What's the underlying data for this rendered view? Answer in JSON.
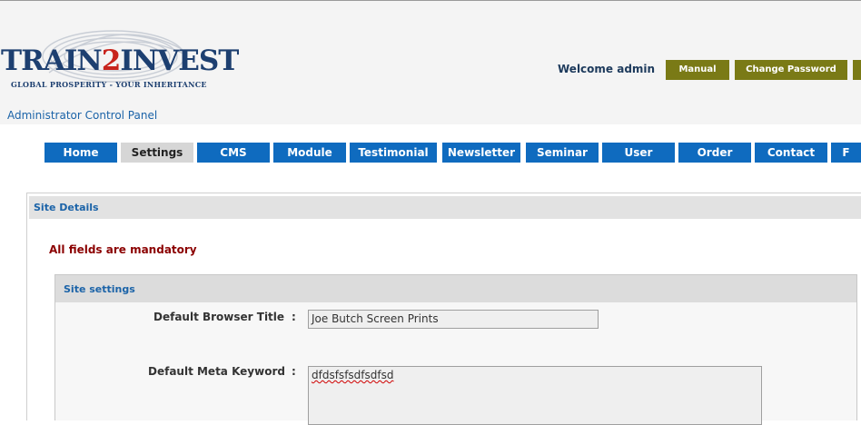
{
  "branding": {
    "logo_main_a": "TRAIN",
    "logo_main_b": "2",
    "logo_main_c": "INVEST",
    "logo_tagline": "GLOBAL PROSPERITY - YOUR INHERITANCE",
    "panel_title": "Administrator Control Panel"
  },
  "header": {
    "welcome": "Welcome admin",
    "buttons": [
      {
        "label": "Manual"
      },
      {
        "label": "Change Password"
      },
      {
        "label": ""
      }
    ]
  },
  "nav": {
    "items": [
      {
        "label": "Home"
      },
      {
        "label": "Settings",
        "active": true
      },
      {
        "label": "CMS"
      },
      {
        "label": "Module"
      },
      {
        "label": "Testimonial"
      },
      {
        "label": "Newsletter"
      },
      {
        "label": "Seminar"
      },
      {
        "label": "User"
      },
      {
        "label": "Order"
      },
      {
        "label": "Contact"
      },
      {
        "label": "F"
      }
    ]
  },
  "content": {
    "section_title": "Site Details",
    "mandatory_note": "All fields are mandatory",
    "settings_title": "Site settings",
    "fields": [
      {
        "label": "Default Browser Title",
        "colon": ":",
        "value": "Joe Butch Screen Prints"
      },
      {
        "label": "Default Meta Keyword",
        "colon": ":",
        "value": "dfdsfsfsdfsdfsd"
      }
    ]
  },
  "colors": {
    "nav_blue": "#0f6bbf",
    "nav_active": "#d6d6d6",
    "olive_button": "#7a7a16",
    "mandatory_red": "#8b0000",
    "link_blue": "#1b63a8"
  }
}
